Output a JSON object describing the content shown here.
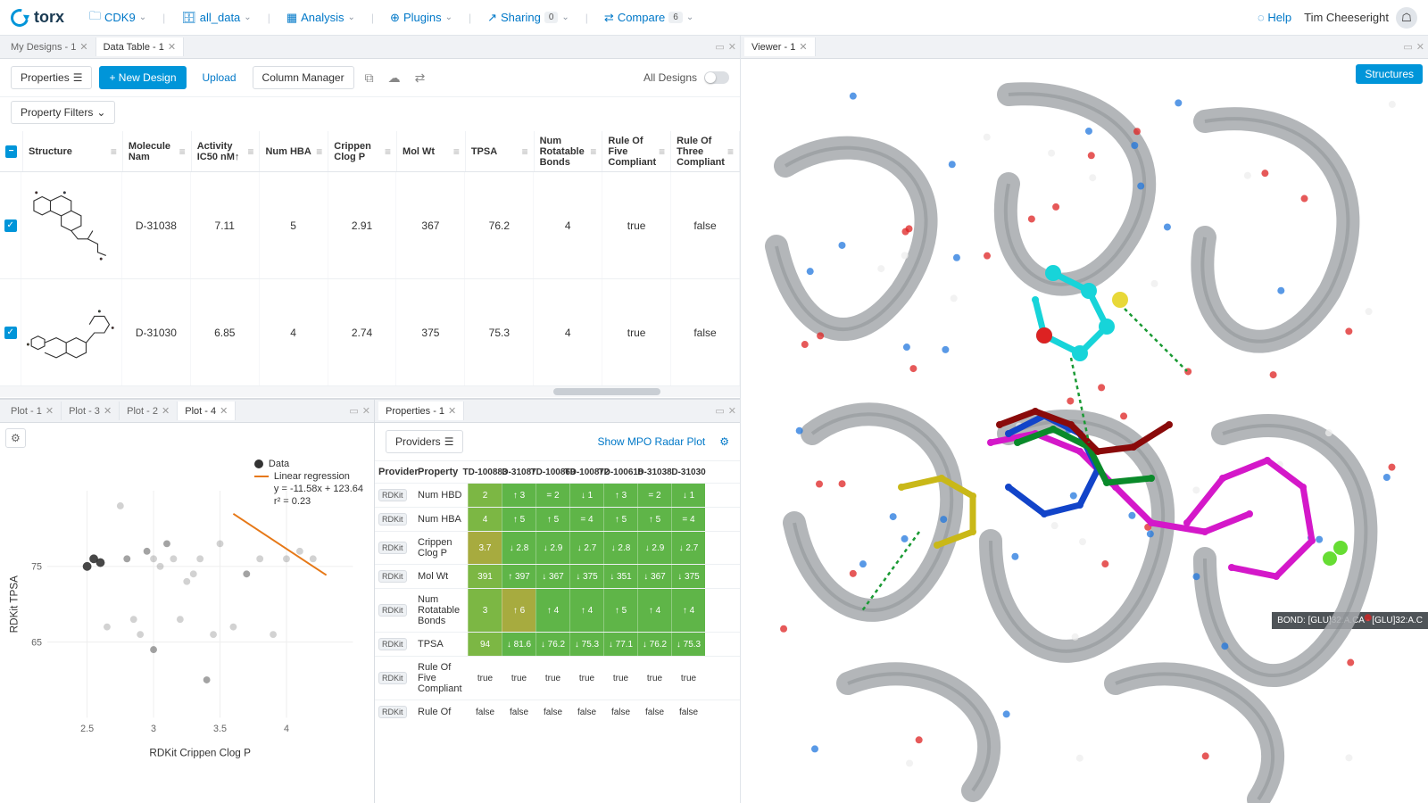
{
  "app": {
    "name": "torx",
    "help_label": "Help",
    "user_name": "Tim Cheeseright"
  },
  "nav": [
    {
      "id": "cdk9",
      "icon": "folder",
      "label": "CDK9"
    },
    {
      "id": "alldata",
      "icon": "db",
      "label": "all_data"
    },
    {
      "id": "analysis",
      "icon": "table",
      "label": "Analysis"
    },
    {
      "id": "plugins",
      "icon": "plus",
      "label": "Plugins"
    },
    {
      "id": "sharing",
      "icon": "share",
      "label": "Sharing",
      "badge": "0"
    },
    {
      "id": "compare",
      "icon": "compare",
      "label": "Compare",
      "badge": "6"
    }
  ],
  "left_tabs": [
    {
      "label": "My Designs - 1",
      "active": false
    },
    {
      "label": "Data Table - 1",
      "active": true
    }
  ],
  "datatable_toolbar": {
    "properties_label": "Properties",
    "new_design_label": "+ New Design",
    "upload_label": "Upload",
    "column_manager_label": "Column Manager",
    "all_designs_label": "All Designs",
    "property_filters_label": "Property Filters"
  },
  "columns": [
    "Structure",
    "Molecule Nam",
    "Activity IC50 nM",
    "Num HBA",
    "Crippen Clog P",
    "Mol Wt",
    "TPSA",
    "Num Rotatable Bonds",
    "Rule Of Five Compliant",
    "Rule Of Three Compliant"
  ],
  "rows": [
    {
      "name": "D-31038",
      "ic50": "7.11",
      "hba": "5",
      "clogp": "2.91",
      "mw": "367",
      "tpsa": "76.2",
      "rot": "4",
      "ro5": "true",
      "ro3": "false"
    },
    {
      "name": "D-31030",
      "ic50": "6.85",
      "hba": "4",
      "clogp": "2.74",
      "mw": "375",
      "tpsa": "75.3",
      "rot": "4",
      "ro5": "true",
      "ro3": "false"
    }
  ],
  "plot_tabs": [
    {
      "label": "Plot - 1"
    },
    {
      "label": "Plot - 3"
    },
    {
      "label": "Plot - 2"
    },
    {
      "label": "Plot - 4",
      "active": true
    }
  ],
  "plot": {
    "xlabel": "RDKit Crippen Clog P",
    "ylabel": "RDKit TPSA",
    "legend_data": "Data",
    "legend_fit": "Linear regression",
    "eq1": "y = -11.58x + 123.64",
    "eq2": "r² = 0.23",
    "xticks": [
      "2.5",
      "3",
      "3.5",
      "4"
    ],
    "yticks": [
      "65",
      "75"
    ]
  },
  "chart_data": {
    "type": "scatter",
    "title": "",
    "xlabel": "RDKit Crippen Clog P",
    "ylabel": "RDKit TPSA",
    "xlim": [
      2.2,
      4.5
    ],
    "ylim": [
      55,
      85
    ],
    "fit": {
      "slope": -11.58,
      "intercept": 123.64,
      "r2": 0.23
    },
    "points": [
      {
        "x": 2.5,
        "y": 75,
        "w": 1
      },
      {
        "x": 2.55,
        "y": 76,
        "w": 1
      },
      {
        "x": 2.6,
        "y": 75.5,
        "w": 2
      },
      {
        "x": 2.65,
        "y": 67,
        "w": 0.3
      },
      {
        "x": 2.75,
        "y": 83,
        "w": 0.3
      },
      {
        "x": 2.8,
        "y": 76,
        "w": 0.5
      },
      {
        "x": 2.85,
        "y": 68,
        "w": 0.3
      },
      {
        "x": 2.9,
        "y": 66,
        "w": 0.3
      },
      {
        "x": 2.95,
        "y": 77,
        "w": 0.7
      },
      {
        "x": 3.0,
        "y": 76,
        "w": 0.3
      },
      {
        "x": 3.0,
        "y": 64,
        "w": 0.5
      },
      {
        "x": 3.05,
        "y": 75,
        "w": 0.3
      },
      {
        "x": 3.1,
        "y": 78,
        "w": 0.5
      },
      {
        "x": 3.15,
        "y": 76,
        "w": 0.3
      },
      {
        "x": 3.2,
        "y": 68,
        "w": 0.3
      },
      {
        "x": 3.25,
        "y": 73,
        "w": 0.3
      },
      {
        "x": 3.3,
        "y": 74,
        "w": 0.3
      },
      {
        "x": 3.35,
        "y": 76,
        "w": 0.3
      },
      {
        "x": 3.4,
        "y": 60,
        "w": 0.7
      },
      {
        "x": 3.45,
        "y": 66,
        "w": 0.3
      },
      {
        "x": 3.5,
        "y": 78,
        "w": 0.3
      },
      {
        "x": 3.6,
        "y": 67,
        "w": 0.3
      },
      {
        "x": 3.7,
        "y": 74,
        "w": 0.5
      },
      {
        "x": 3.8,
        "y": 76,
        "w": 0.3
      },
      {
        "x": 3.9,
        "y": 66,
        "w": 0.3
      },
      {
        "x": 4.0,
        "y": 76,
        "w": 0.3
      },
      {
        "x": 4.1,
        "y": 77,
        "w": 0.3
      },
      {
        "x": 4.2,
        "y": 76,
        "w": 0.3
      }
    ]
  },
  "props_tab": {
    "label": "Properties - 1"
  },
  "props_toolbar": {
    "providers_label": "Providers",
    "radar_link": "Show MPO Radar Plot"
  },
  "props_header": {
    "provider": "Provider",
    "property": "Property"
  },
  "props_cols": [
    "TD-100883",
    "D-31087",
    "TD-100869",
    "TD-100872",
    "TD-100618",
    "D-31038",
    "D-31030"
  ],
  "props_rows": [
    {
      "prop": "Num HBD",
      "vals": [
        "2",
        "↑ 3",
        "= 2",
        "↓ 1",
        "↑ 3",
        "= 2",
        "↓ 1"
      ]
    },
    {
      "prop": "Num HBA",
      "vals": [
        "4",
        "↑ 5",
        "↑ 5",
        "= 4",
        "↑ 5",
        "↑ 5",
        "= 4"
      ]
    },
    {
      "prop": "Crippen Clog P",
      "vals": [
        "3.7",
        "↓ 2.8",
        "↓ 2.9",
        "↓ 2.7",
        "↓ 2.8",
        "↓ 2.9",
        "↓ 2.7"
      ],
      "ref_warn": true
    },
    {
      "prop": "Mol Wt",
      "vals": [
        "391",
        "↑ 397",
        "↓ 367",
        "↓ 375",
        "↓ 351",
        "↓ 367",
        "↓ 375"
      ]
    },
    {
      "prop": "Num Rotatable Bonds",
      "vals": [
        "3",
        "↑ 6",
        "↑ 4",
        "↑ 4",
        "↑ 5",
        "↑ 4",
        "↑ 4"
      ],
      "warn_col": 1
    },
    {
      "prop": "TPSA",
      "vals": [
        "94",
        "↓ 81.6",
        "↓ 76.2",
        "↓ 75.3",
        "↓ 77.1",
        "↓ 76.2",
        "↓ 75.3"
      ]
    },
    {
      "prop": "Rule Of Five Compliant",
      "vals": [
        "true",
        "true",
        "true",
        "true",
        "true",
        "true",
        "true"
      ],
      "plain": true
    },
    {
      "prop": "Rule Of",
      "vals": [
        "false",
        "false",
        "false",
        "false",
        "false",
        "false",
        "false"
      ],
      "plain": true
    }
  ],
  "viewer_tab": {
    "label": "Viewer - 1"
  },
  "viewer": {
    "structures_label": "Structures",
    "bond_tooltip": "BOND:\n[GLU]32:A.CA\n- [GLU]32:A.C"
  }
}
